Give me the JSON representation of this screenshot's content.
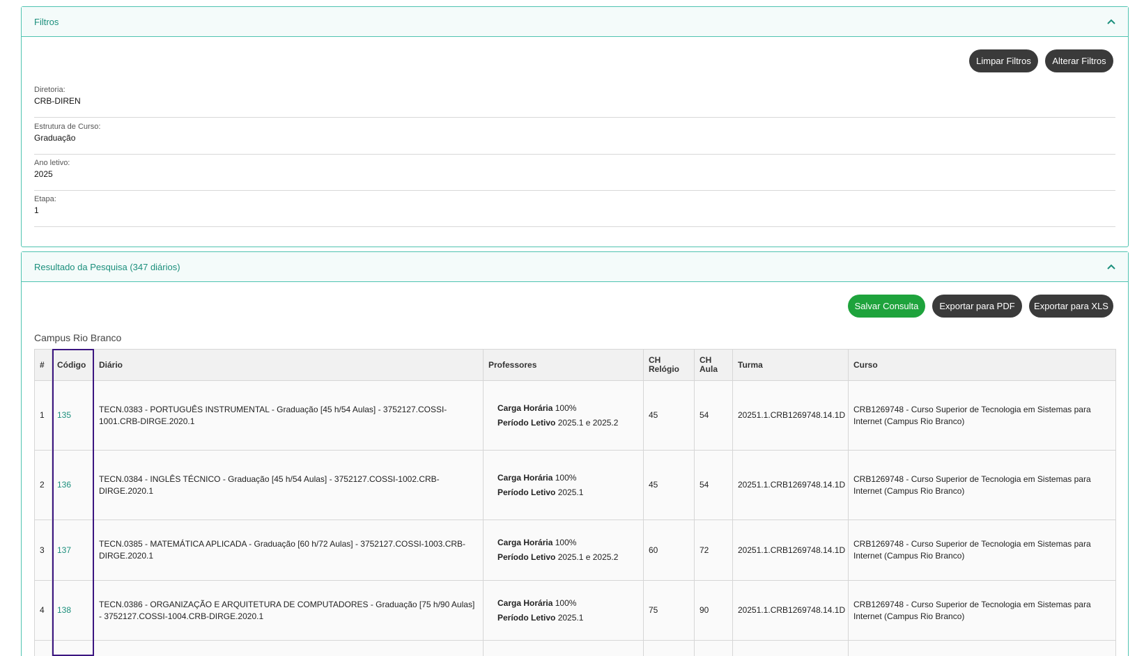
{
  "filters_panel": {
    "title": "Filtros",
    "clear_button": "Limpar Filtros",
    "change_button": "Alterar Filtros",
    "fields": [
      {
        "label": "Diretoria:",
        "value": "CRB-DIREN"
      },
      {
        "label": "Estrutura de Curso:",
        "value": "Graduação"
      },
      {
        "label": "Ano letivo:",
        "value": "2025"
      },
      {
        "label": "Etapa:",
        "value": "1"
      }
    ]
  },
  "results_panel": {
    "title": "Resultado da Pesquisa (347 diários)",
    "save_button": "Salvar Consulta",
    "pdf_button": "Exportar para PDF",
    "xls_button": "Exportar para XLS",
    "campus": "Campus Rio Branco",
    "columns": {
      "num": "#",
      "code": "Código",
      "diary": "Diário",
      "professors": "Professores",
      "ch_clock_1": "CH",
      "ch_clock_2": "Relógio",
      "ch_class_1": "CH",
      "ch_class_2": "Aula",
      "group": "Turma",
      "course": "Curso"
    },
    "prof_labels": {
      "workload": "Carga Horária",
      "period": "Período Letivo"
    },
    "rows": [
      {
        "num": "1",
        "code": "135",
        "diary": "TECN.0383 - PORTUGUÊS INSTRUMENTAL - Graduação [45 h/54 Aulas] - 3752127.COSSI-1001.CRB-DIRGE.2020.1",
        "workload": "100%",
        "period": "2025.1 e 2025.2",
        "ch_clock": "45",
        "ch_class": "54",
        "group": "20251.1.CRB1269748.14.1D",
        "course": "CRB1269748 - Curso Superior de Tecnologia em Sistemas para Internet (Campus Rio Branco)"
      },
      {
        "num": "2",
        "code": "136",
        "diary": "TECN.0384 - INGLÊS TÉCNICO - Graduação [45 h/54 Aulas] - 3752127.COSSI-1002.CRB-DIRGE.2020.1",
        "workload": "100%",
        "period": "2025.1",
        "ch_clock": "45",
        "ch_class": "54",
        "group": "20251.1.CRB1269748.14.1D",
        "course": "CRB1269748 - Curso Superior de Tecnologia em Sistemas para Internet (Campus Rio Branco)"
      },
      {
        "num": "3",
        "code": "137",
        "diary": "TECN.0385 - MATEMÁTICA APLICADA - Graduação [60 h/72 Aulas] - 3752127.COSSI-1003.CRB-DIRGE.2020.1",
        "workload": "100%",
        "period": "2025.1 e 2025.2",
        "ch_clock": "60",
        "ch_class": "72",
        "group": "20251.1.CRB1269748.14.1D",
        "course": "CRB1269748 - Curso Superior de Tecnologia em Sistemas para Internet (Campus Rio Branco)"
      },
      {
        "num": "4",
        "code": "138",
        "diary": "TECN.0386 - ORGANIZAÇÃO E ARQUITETURA DE COMPUTADORES - Graduação [75 h/90 Aulas] - 3752127.COSSI-1004.CRB-DIRGE.2020.1",
        "workload": "100%",
        "period": "2025.1",
        "ch_clock": "75",
        "ch_class": "90",
        "group": "20251.1.CRB1269748.14.1D",
        "course": "CRB1269748 - Curso Superior de Tecnologia em Sistemas para Internet (Campus Rio Branco)"
      }
    ]
  }
}
